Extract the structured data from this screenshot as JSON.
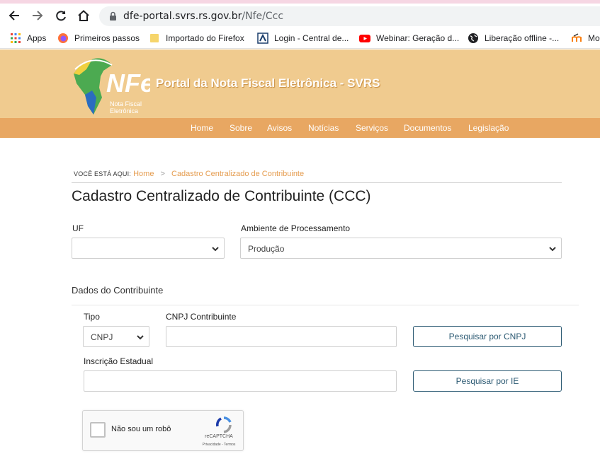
{
  "browser": {
    "url_host": "dfe-portal.svrs.rs.gov.br",
    "url_path": "/Nfe/Ccc",
    "bookmarks": [
      {
        "label": "Apps",
        "icon": "apps-grid-icon"
      },
      {
        "label": "Primeiros passos",
        "icon": "firefox-icon"
      },
      {
        "label": "Importado do Firefox",
        "icon": "folder-icon"
      },
      {
        "label": "Login - Central de...",
        "icon": "site-icon"
      },
      {
        "label": "Webinar: Geração d...",
        "icon": "youtube-icon"
      },
      {
        "label": "Liberação offline -...",
        "icon": "globe-icon"
      },
      {
        "label": "Mo",
        "icon": "moodle-icon"
      }
    ]
  },
  "site": {
    "logo_text": "NFe",
    "logo_sub1": "Nota Fiscal",
    "logo_sub2": "Eletrônica",
    "title": "Portal da Nota Fiscal Eletrônica - SVRS",
    "nav": [
      "Home",
      "Sobre",
      "Avisos",
      "Notícias",
      "Serviços",
      "Documentos",
      "Legislação"
    ],
    "colors": {
      "header": "#f0cb8f",
      "nav": "#e8a762",
      "accent": "#e59c4f",
      "button": "#2c5a73"
    }
  },
  "breadcrumb": {
    "label": "VOCÊ ESTÁ AQUI:",
    "home": "Home",
    "separator": ">",
    "current": "Cadastro Centralizado de Contribuinte"
  },
  "page": {
    "title": "Cadastro Centralizado de Contribuinte (CCC)"
  },
  "filters": {
    "uf_label": "UF",
    "uf_value": "",
    "ambiente_label": "Ambiente de Processamento",
    "ambiente_value": "Produção"
  },
  "contribuinte": {
    "section_title": "Dados do Contribuinte",
    "tipo_label": "Tipo",
    "tipo_value": "CNPJ",
    "cnpj_label": "CNPJ Contribuinte",
    "cnpj_value": "",
    "search_cnpj_button": "Pesquisar por CNPJ",
    "ie_label": "Inscrição Estadual",
    "ie_value": "",
    "search_ie_button": "Pesquisar por IE"
  },
  "captcha": {
    "label": "Não sou um robô",
    "brand": "reCAPTCHA",
    "terms": "Privacidade - Termos"
  }
}
